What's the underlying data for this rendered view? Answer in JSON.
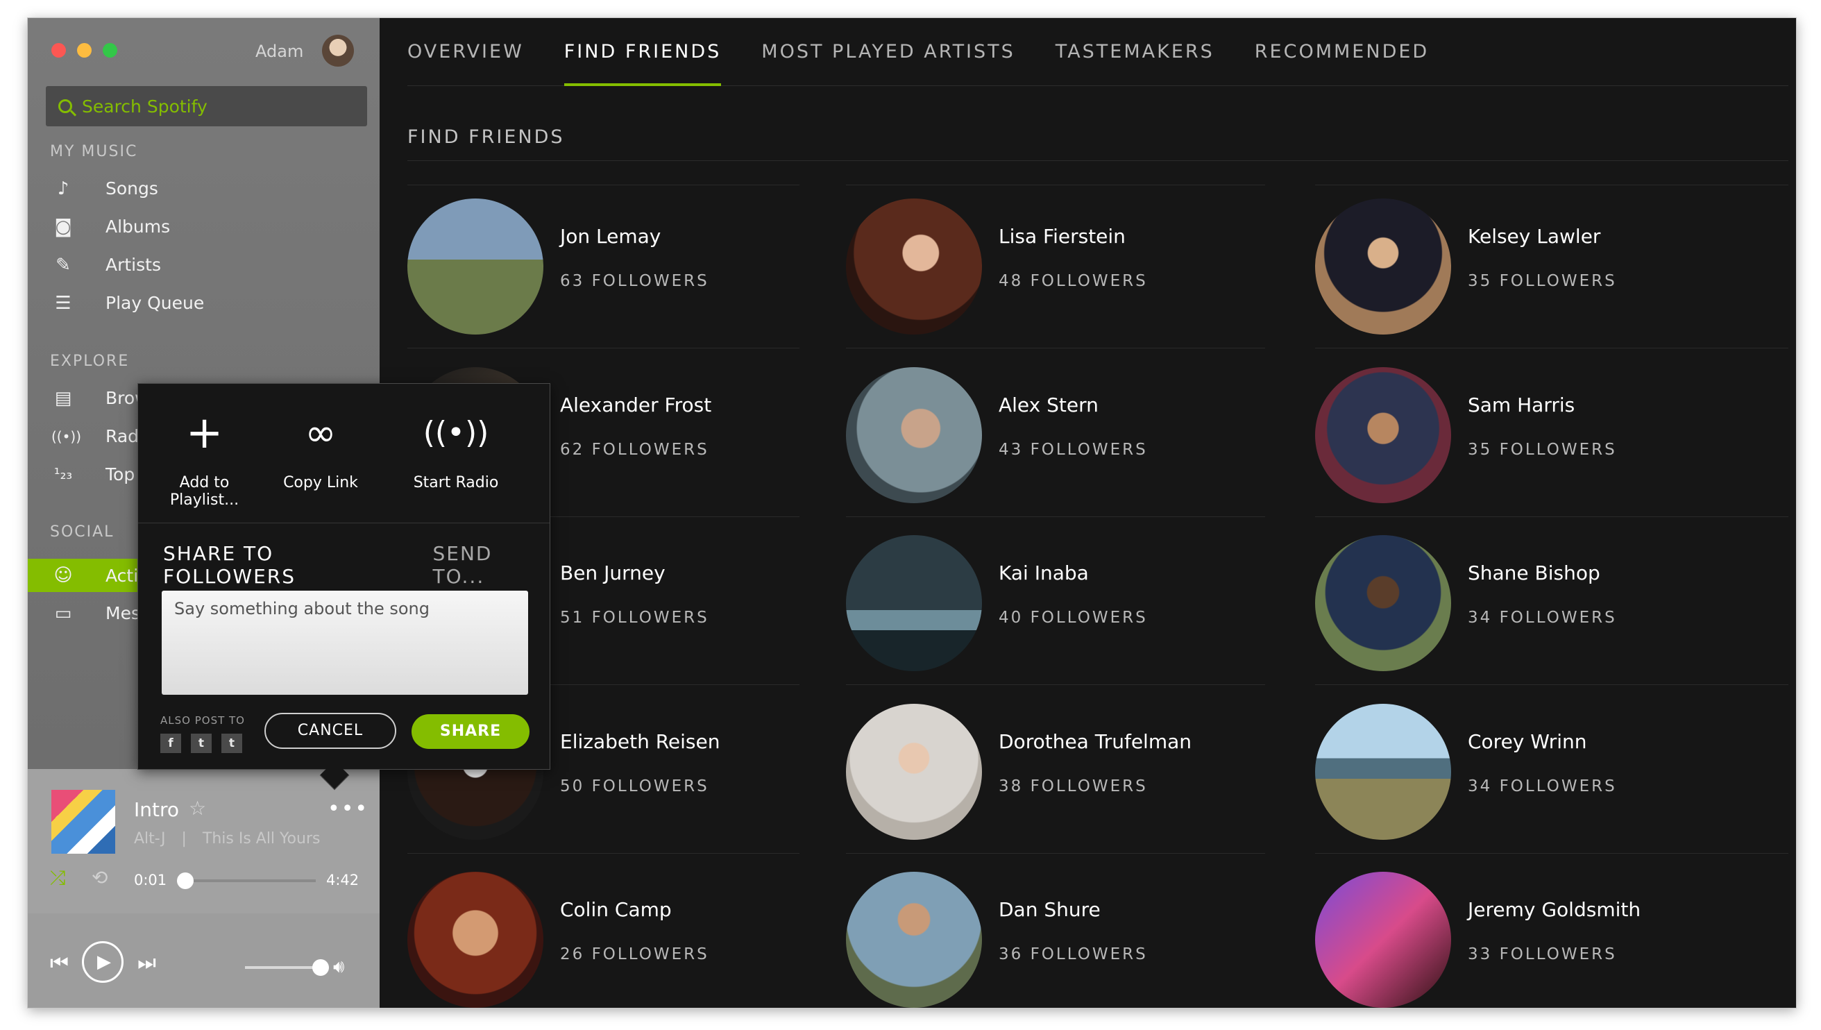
{
  "window": {
    "traffic_lights": [
      "#ff5f57",
      "#febc2e",
      "#28c840"
    ]
  },
  "sidebar": {
    "user_name": "Adam",
    "search_placeholder": "Search Spotify",
    "my_music_title": "MY MUSIC",
    "my_music": [
      {
        "label": "Songs",
        "icon": "music-note-icon"
      },
      {
        "label": "Albums",
        "icon": "album-icon"
      },
      {
        "label": "Artists",
        "icon": "microphone-icon"
      },
      {
        "label": "Play Queue",
        "icon": "list-icon"
      }
    ],
    "explore_title": "EXPLORE",
    "explore": [
      {
        "label": "Browse",
        "icon": "browse-icon"
      },
      {
        "label": "Radio",
        "icon": "radio-icon"
      },
      {
        "label": "Top Lists",
        "icon": "top-lists-icon"
      }
    ],
    "social_title": "SOCIAL",
    "social": [
      {
        "label": "Activity",
        "icon": "activity-icon",
        "active": true
      },
      {
        "label": "Messages",
        "icon": "inbox-icon"
      }
    ]
  },
  "player": {
    "track": "Intro",
    "artist": "Alt-J",
    "separator": "|",
    "album": "This Is All Yours",
    "elapsed": "0:01",
    "duration": "4:42"
  },
  "tabs": [
    "OVERVIEW",
    "FIND FRIENDS",
    "MOST PLAYED ARTISTS",
    "TASTEMAKERS",
    "RECOMMENDED"
  ],
  "active_tab": "FIND FRIENDS",
  "section_title": "FIND FRIENDS",
  "friends": [
    {
      "name": "Jon Lemay",
      "followers": "63 FOLLOWERS"
    },
    {
      "name": "Lisa Fierstein",
      "followers": "48 FOLLOWERS"
    },
    {
      "name": "Kelsey Lawler",
      "followers": "35 FOLLOWERS"
    },
    {
      "name": "Alexander Frost",
      "followers": "62 FOLLOWERS"
    },
    {
      "name": "Alex Stern",
      "followers": "43 FOLLOWERS"
    },
    {
      "name": "Sam Harris",
      "followers": "35 FOLLOWERS"
    },
    {
      "name": "Ben Jurney",
      "followers": "51 FOLLOWERS"
    },
    {
      "name": "Kai Inaba",
      "followers": "40 FOLLOWERS"
    },
    {
      "name": "Shane Bishop",
      "followers": "34 FOLLOWERS"
    },
    {
      "name": "Elizabeth Reisen",
      "followers": "50 FOLLOWERS"
    },
    {
      "name": "Dorothea Trufelman",
      "followers": "38 FOLLOWERS"
    },
    {
      "name": "Corey Wrinn",
      "followers": "34 FOLLOWERS"
    },
    {
      "name": "Colin Camp",
      "followers": "26 FOLLOWERS"
    },
    {
      "name": "Dan Shure",
      "followers": "36 FOLLOWERS"
    },
    {
      "name": "Jeremy Goldsmith",
      "followers": "33 FOLLOWERS"
    }
  ],
  "popover": {
    "actions": [
      "Add to Playlist...",
      "Copy Link",
      "Start Radio"
    ],
    "tab_share": "SHARE TO FOLLOWERS",
    "tab_send": "SEND TO...",
    "textarea_placeholder": "Say something about the song",
    "also_post_to": "ALSO POST TO",
    "social_buttons": [
      "f",
      "t",
      "t"
    ],
    "cancel": "CANCEL",
    "share": "SHARE"
  },
  "colors": {
    "accent": "#84bd00",
    "background": "#161616",
    "sidebar": "#6f6f6f"
  }
}
